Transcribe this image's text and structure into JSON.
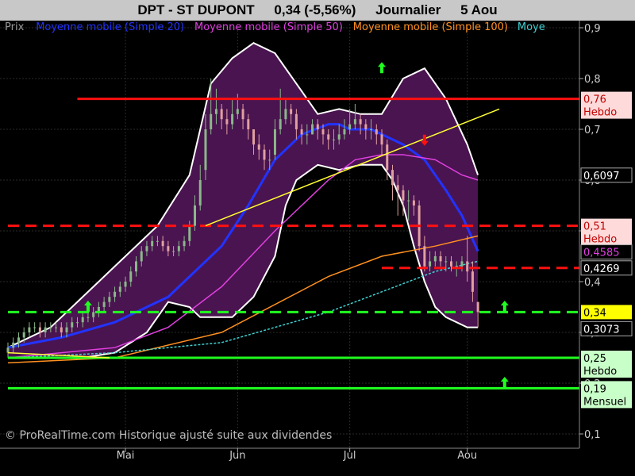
{
  "header": {
    "ticker": "DPT - ST DUPONT",
    "change": "0,34 (-5,56%)",
    "period": "Journalier",
    "date": "5 Aou"
  },
  "legend": [
    {
      "text": "Prix",
      "color": "#9a9a9a"
    },
    {
      "text": "Moyenne mobile (Simple 20)",
      "color": "#2233ff"
    },
    {
      "text": "Moyenne mobile (Simple 50)",
      "color": "#e040e0"
    },
    {
      "text": "Moyenne mobile (Simple 100)",
      "color": "#ff9020"
    },
    {
      "text": "Moye",
      "color": "#40d0d0"
    }
  ],
  "copyright": "© ProRealTime.com Historique ajusté suite aux dividendes",
  "price_labels": [
    {
      "text": "0,76",
      "sub": "Hebdo",
      "value": 0.76,
      "bg": "#ffdada",
      "fg": "#c00000"
    },
    {
      "text": "0,6097",
      "value": 0.6097,
      "bg": "#000000",
      "fg": "#ffffff"
    },
    {
      "text": "0,51",
      "sub": "Hebdo",
      "value": 0.51,
      "bg": "#ffdada",
      "fg": "#c00000"
    },
    {
      "text": "0,4585",
      "value": 0.4585,
      "bg": "#000000",
      "fg": "#e040e0"
    },
    {
      "text": "0,4269",
      "value": 0.4269,
      "bg": "#000000",
      "fg": "#ffffff"
    },
    {
      "text": "0,34",
      "value": 0.34,
      "bg": "#ffff00",
      "fg": "#000000"
    },
    {
      "text": "0,3073",
      "value": 0.3073,
      "bg": "#000000",
      "fg": "#ffffff"
    },
    {
      "text": "0,25",
      "sub": "Hebdo",
      "value": 0.25,
      "bg": "#c8ffc8",
      "fg": "#000000"
    },
    {
      "text": "0,19",
      "sub": "Mensuel",
      "value": 0.19,
      "bg": "#c8ffc8",
      "fg": "#000000"
    }
  ],
  "colors": {
    "up_candle": "#8ab88a",
    "down_candle": "#e0a0a0",
    "bollinger_fill": "#4a1450",
    "resistance": "#ff1010",
    "support": "#20ff20"
  },
  "chart_data": {
    "type": "line",
    "title": "DPT - ST DUPONT",
    "ylim": [
      0.1,
      0.9
    ],
    "y_ticks": [
      0.1,
      0.2,
      0.3,
      0.4,
      0.5,
      0.6,
      0.7,
      0.8,
      0.9
    ],
    "y_tick_labels": [
      "0,1",
      "0,2",
      "0,3",
      "0,4",
      "0,5",
      "0,6",
      "0,7",
      "0,8",
      "0,9"
    ],
    "x_ticks": [
      {
        "label": "Mai",
        "day": 22
      },
      {
        "label": "Jun",
        "day": 43
      },
      {
        "label": "Jul",
        "day": 64
      },
      {
        "label": "Aou",
        "day": 86
      }
    ],
    "x_range": [
      0,
      107
    ],
    "close": [
      0.27,
      0.28,
      0.29,
      0.3,
      0.31,
      0.31,
      0.3,
      0.31,
      0.31,
      0.31,
      0.3,
      0.31,
      0.32,
      0.32,
      0.33,
      0.33,
      0.34,
      0.35,
      0.36,
      0.37,
      0.38,
      0.39,
      0.4,
      0.42,
      0.44,
      0.46,
      0.47,
      0.48,
      0.48,
      0.47,
      0.46,
      0.46,
      0.47,
      0.48,
      0.51,
      0.55,
      0.6,
      0.7,
      0.73,
      0.74,
      0.72,
      0.71,
      0.73,
      0.74,
      0.72,
      0.7,
      0.67,
      0.66,
      0.64,
      0.64,
      0.7,
      0.72,
      0.74,
      0.73,
      0.7,
      0.69,
      0.69,
      0.71,
      0.7,
      0.69,
      0.68,
      0.68,
      0.69,
      0.7,
      0.71,
      0.72,
      0.71,
      0.7,
      0.7,
      0.69,
      0.67,
      0.62,
      0.59,
      0.58,
      0.56,
      0.56,
      0.55,
      0.47,
      0.43,
      0.44,
      0.45,
      0.44,
      0.44,
      0.43,
      0.43,
      0.44,
      0.42,
      0.38,
      0.34
    ],
    "open": [
      0.26,
      0.27,
      0.28,
      0.29,
      0.3,
      0.31,
      0.31,
      0.3,
      0.31,
      0.31,
      0.31,
      0.3,
      0.31,
      0.32,
      0.32,
      0.33,
      0.33,
      0.34,
      0.35,
      0.36,
      0.37,
      0.38,
      0.39,
      0.4,
      0.42,
      0.44,
      0.46,
      0.47,
      0.48,
      0.48,
      0.47,
      0.46,
      0.46,
      0.47,
      0.48,
      0.51,
      0.55,
      0.62,
      0.7,
      0.73,
      0.74,
      0.72,
      0.71,
      0.73,
      0.74,
      0.72,
      0.7,
      0.67,
      0.66,
      0.64,
      0.65,
      0.7,
      0.72,
      0.74,
      0.73,
      0.7,
      0.69,
      0.69,
      0.71,
      0.7,
      0.69,
      0.68,
      0.68,
      0.69,
      0.7,
      0.71,
      0.72,
      0.71,
      0.7,
      0.7,
      0.69,
      0.67,
      0.62,
      0.59,
      0.58,
      0.56,
      0.56,
      0.55,
      0.47,
      0.43,
      0.44,
      0.45,
      0.44,
      0.44,
      0.43,
      0.43,
      0.44,
      0.42,
      0.36
    ],
    "high": [
      0.28,
      0.29,
      0.3,
      0.31,
      0.32,
      0.32,
      0.32,
      0.32,
      0.32,
      0.32,
      0.32,
      0.32,
      0.33,
      0.33,
      0.34,
      0.34,
      0.35,
      0.36,
      0.37,
      0.38,
      0.39,
      0.4,
      0.41,
      0.43,
      0.45,
      0.47,
      0.48,
      0.49,
      0.49,
      0.49,
      0.48,
      0.47,
      0.48,
      0.49,
      0.52,
      0.57,
      0.63,
      0.73,
      0.8,
      0.78,
      0.75,
      0.74,
      0.76,
      0.77,
      0.75,
      0.73,
      0.7,
      0.69,
      0.67,
      0.66,
      0.72,
      0.78,
      0.76,
      0.75,
      0.74,
      0.71,
      0.71,
      0.72,
      0.72,
      0.71,
      0.7,
      0.7,
      0.71,
      0.72,
      0.74,
      0.75,
      0.73,
      0.72,
      0.72,
      0.71,
      0.7,
      0.68,
      0.63,
      0.61,
      0.59,
      0.58,
      0.57,
      0.56,
      0.49,
      0.46,
      0.46,
      0.46,
      0.45,
      0.45,
      0.44,
      0.45,
      0.49,
      0.44,
      0.36
    ],
    "low": [
      0.25,
      0.26,
      0.27,
      0.28,
      0.29,
      0.3,
      0.29,
      0.29,
      0.3,
      0.3,
      0.29,
      0.29,
      0.3,
      0.31,
      0.31,
      0.32,
      0.32,
      0.33,
      0.34,
      0.35,
      0.36,
      0.37,
      0.38,
      0.39,
      0.41,
      0.43,
      0.45,
      0.46,
      0.47,
      0.46,
      0.45,
      0.45,
      0.45,
      0.46,
      0.47,
      0.5,
      0.54,
      0.6,
      0.69,
      0.71,
      0.7,
      0.69,
      0.7,
      0.72,
      0.7,
      0.68,
      0.65,
      0.64,
      0.62,
      0.62,
      0.64,
      0.69,
      0.71,
      0.71,
      0.68,
      0.67,
      0.67,
      0.69,
      0.68,
      0.67,
      0.66,
      0.66,
      0.67,
      0.68,
      0.69,
      0.7,
      0.69,
      0.68,
      0.68,
      0.67,
      0.65,
      0.6,
      0.56,
      0.53,
      0.53,
      0.52,
      0.53,
      0.46,
      0.42,
      0.42,
      0.43,
      0.43,
      0.42,
      0.42,
      0.41,
      0.42,
      0.4,
      0.36,
      0.31
    ],
    "series": [
      {
        "name": "Moyenne mobile (Simple 20)",
        "color": "#2233ff",
        "x": [
          0,
          10,
          20,
          30,
          40,
          45,
          50,
          55,
          60,
          62,
          64,
          66,
          68,
          70,
          74,
          78,
          82,
          85,
          88
        ],
        "values": [
          0.27,
          0.29,
          0.32,
          0.37,
          0.47,
          0.55,
          0.64,
          0.69,
          0.71,
          0.71,
          0.7,
          0.7,
          0.7,
          0.69,
          0.67,
          0.64,
          0.58,
          0.53,
          0.46
        ]
      },
      {
        "name": "Moyenne mobile (Simple 50)",
        "color": "#e040e0",
        "x": [
          0,
          10,
          20,
          30,
          40,
          50,
          60,
          65,
          70,
          74,
          80,
          85,
          88
        ],
        "values": [
          0.25,
          0.26,
          0.27,
          0.31,
          0.39,
          0.5,
          0.6,
          0.64,
          0.65,
          0.65,
          0.64,
          0.61,
          0.6
        ]
      },
      {
        "name": "Moyenne mobile (Simple 100)",
        "color": "#ff9020",
        "x": [
          0,
          20,
          40,
          60,
          70,
          80,
          88
        ],
        "values": [
          0.24,
          0.25,
          0.3,
          0.41,
          0.45,
          0.47,
          0.49
        ]
      },
      {
        "name": "Moye",
        "color": "#40d0d0",
        "x": [
          0,
          20,
          40,
          60,
          70,
          80,
          88
        ],
        "values": [
          0.25,
          0.26,
          0.28,
          0.34,
          0.38,
          0.42,
          0.44
        ]
      }
    ],
    "bollinger_upper": {
      "x": [
        0,
        8,
        16,
        22,
        28,
        34,
        38,
        42,
        46,
        50,
        54,
        58,
        62,
        66,
        70,
        74,
        78,
        82,
        86,
        88
      ],
      "values": [
        0.27,
        0.31,
        0.39,
        0.45,
        0.51,
        0.61,
        0.79,
        0.84,
        0.87,
        0.85,
        0.79,
        0.73,
        0.74,
        0.73,
        0.73,
        0.8,
        0.82,
        0.76,
        0.67,
        0.61
      ]
    },
    "bollinger_lower": {
      "x": [
        0,
        8,
        14,
        20,
        26,
        30,
        34,
        36,
        38,
        42,
        46,
        50,
        52,
        54,
        58,
        62,
        66,
        70,
        72,
        74,
        76,
        78,
        80,
        82,
        86,
        88
      ],
      "values": [
        0.25,
        0.25,
        0.25,
        0.26,
        0.3,
        0.36,
        0.35,
        0.33,
        0.33,
        0.33,
        0.37,
        0.45,
        0.55,
        0.6,
        0.63,
        0.62,
        0.63,
        0.63,
        0.6,
        0.55,
        0.47,
        0.4,
        0.35,
        0.33,
        0.31,
        0.31
      ]
    },
    "trendlines": [
      {
        "color": "#ffff33",
        "from": [
          37,
          0.51
        ],
        "to": [
          92,
          0.74
        ]
      },
      {
        "color": "#ffff33",
        "from": [
          0,
          0.26
        ],
        "to": [
          19,
          0.25
        ]
      }
    ],
    "horizontal_levels": [
      {
        "value": 0.76,
        "color": "#ff1010",
        "style": "solid",
        "from": 13,
        "to": 107
      },
      {
        "value": 0.51,
        "color": "#ff1010",
        "style": "dashed",
        "from": 0,
        "to": 107
      },
      {
        "value": 0.427,
        "color": "#ff1010",
        "style": "dashed",
        "from": 70,
        "to": 107
      },
      {
        "value": 0.34,
        "color": "#20ff20",
        "style": "dashed",
        "from": 0,
        "to": 107
      },
      {
        "value": 0.25,
        "color": "#20ff20",
        "style": "solid",
        "from": 0,
        "to": 107
      },
      {
        "value": 0.19,
        "color": "#20ff20",
        "style": "solid",
        "from": 0,
        "to": 107
      }
    ],
    "arrows": [
      {
        "dir": "up",
        "color": "#20ff20",
        "day": 70,
        "value": 0.82
      },
      {
        "dir": "down",
        "color": "#ff1010",
        "day": 78,
        "value": 0.68
      },
      {
        "dir": "up",
        "color": "#20ff20",
        "day": 15,
        "value": 0.35
      },
      {
        "dir": "up",
        "color": "#20ff20",
        "day": 93,
        "value": 0.35
      },
      {
        "dir": "up",
        "color": "#20ff20",
        "day": 93,
        "value": 0.2
      }
    ]
  }
}
